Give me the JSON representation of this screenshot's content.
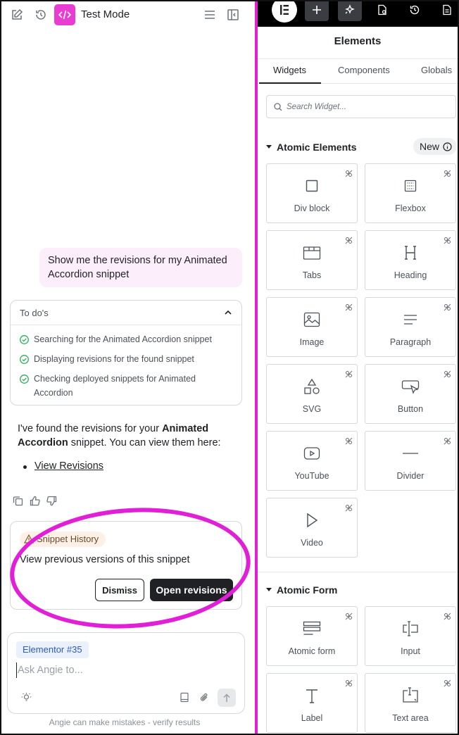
{
  "left": {
    "mode_title": "Test Mode",
    "user_message": "Show me the revisions for my Animated Accordion snippet",
    "todo": {
      "header": "To do's",
      "items": [
        "Searching for the Animated Accordion snippet",
        "Displaying revisions for the found snippet",
        "Checking deployed snippets for Animated Accordion"
      ]
    },
    "answer": {
      "prefix": "I've found the revisions for your ",
      "bold": "Animated Accordion",
      "suffix": " snippet. You can view them here:",
      "link": "View Revisions"
    },
    "history": {
      "badge": "Snippet History",
      "text": "View previous versions of this snippet",
      "dismiss": "Dismiss",
      "open": "Open revisions"
    },
    "composer": {
      "chip": "Elementor #35",
      "placeholder": "Ask Angie to..."
    },
    "disclaimer": "Angie can make mistakes - verify results"
  },
  "right": {
    "title": "Elements",
    "tabs": [
      "Widgets",
      "Components",
      "Globals"
    ],
    "search_placeholder": "Search Widget...",
    "sections": [
      {
        "title": "Atomic Elements",
        "badge": "New",
        "tiles": [
          "Div block",
          "Flexbox",
          "Tabs",
          "Heading",
          "Image",
          "Paragraph",
          "SVG",
          "Button",
          "YouTube",
          "Divider",
          "Video"
        ]
      },
      {
        "title": "Atomic Form",
        "tiles": [
          "Atomic form",
          "Input",
          "Label",
          "Text area"
        ]
      }
    ]
  },
  "colors": {
    "accent_magenta": "#e93cd3",
    "highlight_ring": "#e11fd6",
    "dark_button": "#1f2124",
    "user_bubble": "#fdeefb",
    "todo_check": "#2fae5c"
  }
}
